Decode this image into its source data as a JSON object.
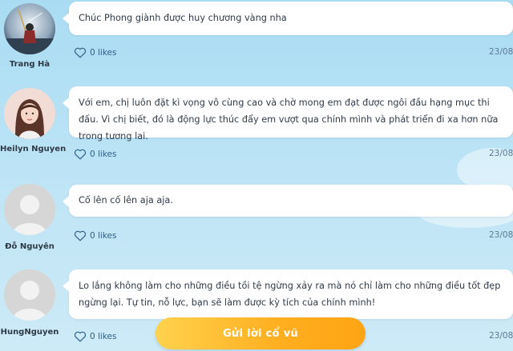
{
  "comments": [
    {
      "name": "Trang Hà",
      "text": "Chúc Phong giành được huy chương vàng nha",
      "likes": "0 likes",
      "date": "23/08",
      "avatar_icon": "anime-character-avatar"
    },
    {
      "name": "Heilyn Nguyen",
      "text": "Với em, chị luôn đặt kì vọng vô cùng cao và chờ mong em đạt được ngôi đầu hạng mục thi đấu. Vì chị biết, đó là động lực thúc đẩy em vượt qua chính mình và phát triển đi xa hơn nữa trong tương lai.",
      "likes": "0 likes",
      "date": "23/08",
      "avatar_icon": "user-photo-avatar"
    },
    {
      "name": "Đỗ Nguyên",
      "text": "Cố lên cố lên aja aja.",
      "likes": "0 likes",
      "date": "23/08",
      "avatar_icon": "default-user-avatar"
    },
    {
      "name": "HungNguyen",
      "text": "Lo lắng không làm cho những điều tồi tệ ngừng xảy ra mà nó chỉ làm cho những điều tốt đẹp ngừng lại. Tự tin, nỗ lực, bạn sẽ làm được kỳ tích của chính mình!",
      "likes": "0 likes",
      "date": "23/08",
      "avatar_icon": "default-user-avatar"
    }
  ],
  "send_button": {
    "label": "Gửi lời cổ vũ"
  },
  "colors": {
    "background": "#bfe5f6",
    "bubble": "#ffffff",
    "button_start": "#ffd24d",
    "button_end": "#ffa414",
    "like_color": "#2e5f88"
  }
}
